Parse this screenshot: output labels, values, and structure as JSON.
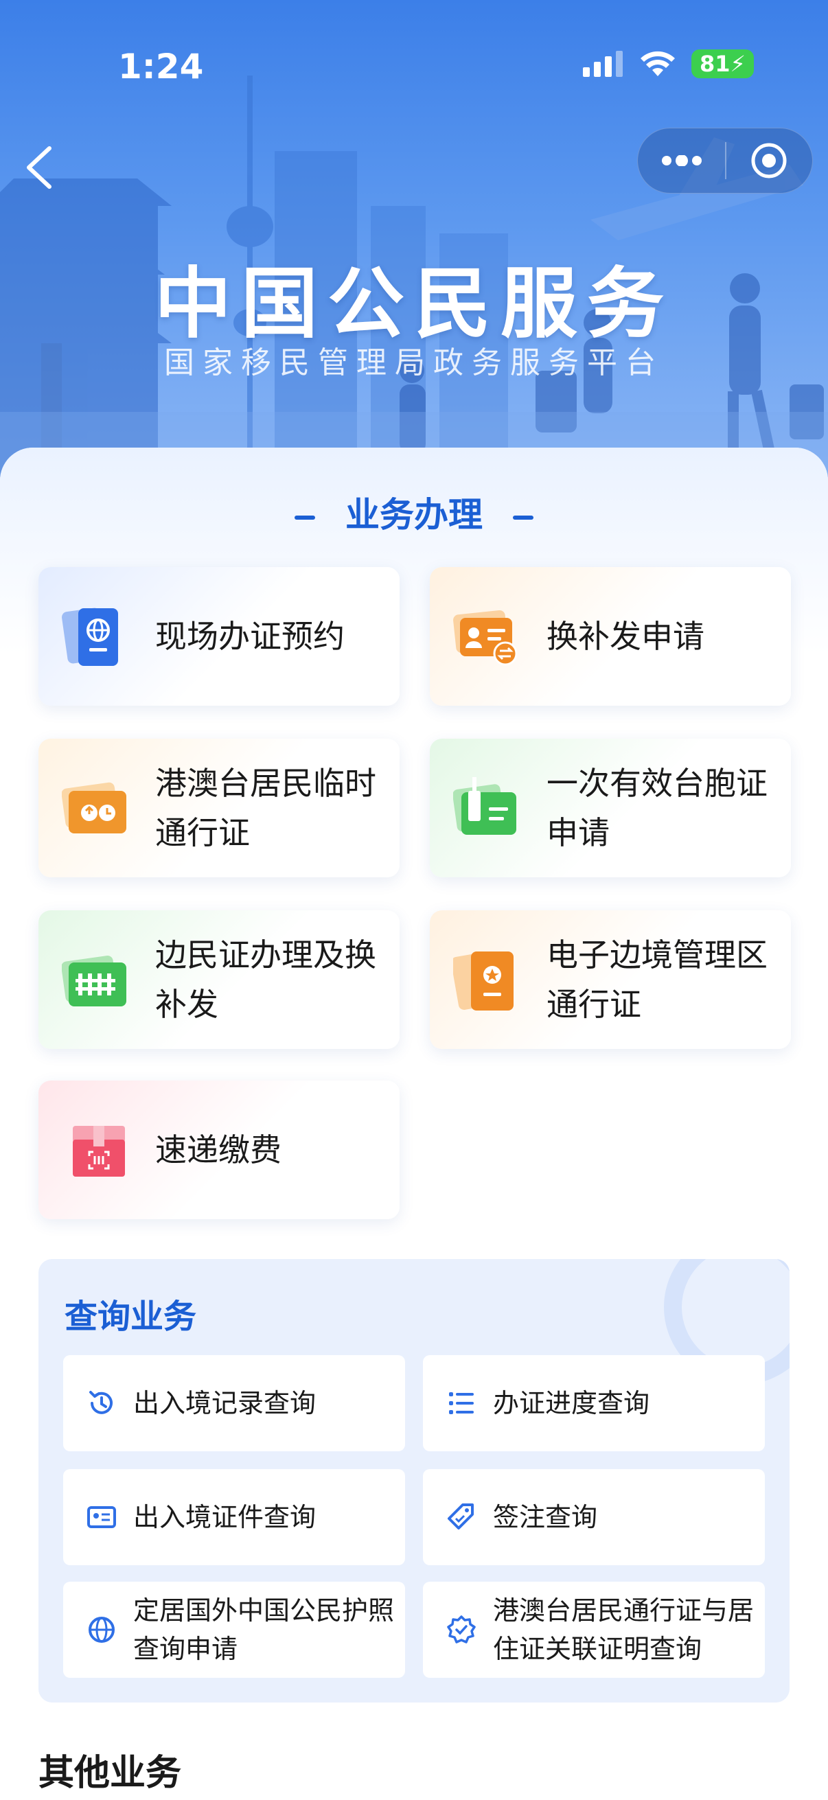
{
  "status_bar": {
    "time": "1:24",
    "battery": "81"
  },
  "header": {
    "title": "中国公民服务",
    "subtitle": "国家移民管理局政务服务平台"
  },
  "business": {
    "heading": "业务办理",
    "items": [
      {
        "label": "现场办证预约",
        "icon": "passport-globe-icon",
        "accent": "#2f6fe6"
      },
      {
        "label": "换补发申请",
        "icon": "id-card-exchange-icon",
        "accent": "#f08a24"
      },
      {
        "label": "港澳台居民临时通行证",
        "icon": "temporary-permit-icon",
        "accent": "#f0962c"
      },
      {
        "label": "一次有效台胞证申请",
        "icon": "taiwan-compatriot-permit-icon",
        "accent": "#3fbf55"
      },
      {
        "label": "边民证办理及换补发",
        "icon": "border-resident-fence-icon",
        "accent": "#3fbf55"
      },
      {
        "label": "电子边境管理区通行证",
        "icon": "border-zone-pass-icon",
        "accent": "#f08a24"
      },
      {
        "label": "速递缴费",
        "icon": "express-payment-box-icon",
        "accent": "#f0506a"
      }
    ]
  },
  "query": {
    "title": "查询业务",
    "items": [
      {
        "label": "出入境记录查询",
        "icon": "history-clock-icon"
      },
      {
        "label": "办证进度查询",
        "icon": "progress-list-icon"
      },
      {
        "label": "出入境证件查询",
        "icon": "document-card-icon"
      },
      {
        "label": "签注查询",
        "icon": "endorsement-tag-icon"
      },
      {
        "label": "定居国外中国公民护照查询申请",
        "icon": "globe-icon"
      },
      {
        "label": "港澳台居民通行证与居住证关联证明查询",
        "icon": "verified-badge-icon"
      }
    ]
  },
  "other": {
    "title": "其他业务"
  },
  "colors": {
    "primary": "#1b5fd4",
    "hero_top": "#3c7fe8",
    "query_bg": "#e9f0fd"
  }
}
